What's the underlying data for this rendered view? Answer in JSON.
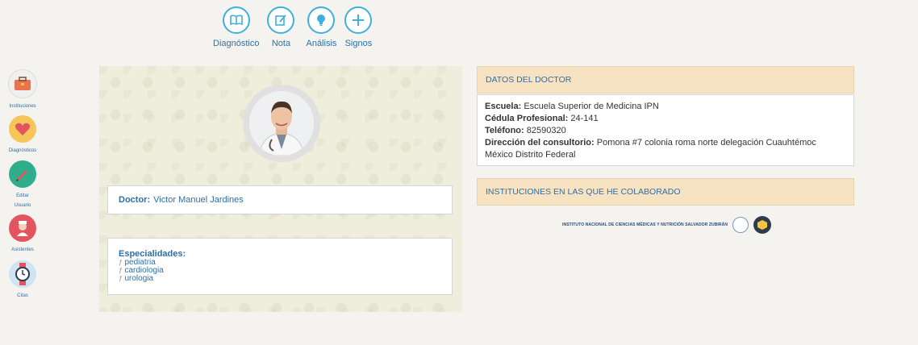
{
  "toolbar": {
    "items": [
      {
        "label": "Diagnóstico",
        "icon": "book-icon"
      },
      {
        "label": "Nota",
        "icon": "edit-icon"
      },
      {
        "label": "Análisis",
        "icon": "lightbulb-icon"
      },
      {
        "label": "Signos",
        "icon": "plus-icon"
      }
    ]
  },
  "sidebar": {
    "items": [
      {
        "label": "Instituciones",
        "icon": "briefcase-icon",
        "color": "#f4f4f4"
      },
      {
        "label": "Diagnósticos",
        "icon": "heart-icon",
        "color": "#f7c65a"
      },
      {
        "label": "Editar Usuario",
        "icon": "pencil-icon",
        "color": "#2fae8c"
      },
      {
        "label": "Asistentes",
        "icon": "nurse-icon",
        "color": "#e2555e"
      },
      {
        "label": "Citas",
        "icon": "watch-icon",
        "color": "#cfe4f0"
      }
    ]
  },
  "profile": {
    "doctor_label": "Doctor:",
    "doctor_name": "Victor Manuel Jardines",
    "specialties_label": "Especialidades:",
    "specialties": [
      "pediatria",
      "cardiologia",
      "urologia"
    ]
  },
  "doctor_data": {
    "header": "DATOS DEL DOCTOR",
    "school_label": "Escuela:",
    "school": "Escuela Superior de Medicina IPN",
    "license_label": "Cédula Profesional:",
    "license": "24-141",
    "phone_label": "Teléfono:",
    "phone": "82590320",
    "address_label": "Dirección del consultorio:",
    "address": "Pomona #7 colonia roma norte delegación Cuauhtémoc México Distrito Federal"
  },
  "institutions": {
    "header": "INSTITUCIONES EN LAS QUE HE COLABORADO",
    "items": [
      {
        "name": "INSTITUTO NACIONAL DE CIENCIAS MÉDICAS Y NUTRICIÓN SALVADOR ZUBIRÁN"
      }
    ]
  },
  "colors": {
    "accent": "#2d6fa8",
    "toolbar_ring": "#3fb0d9",
    "header_bg": "#f7e3c2"
  }
}
